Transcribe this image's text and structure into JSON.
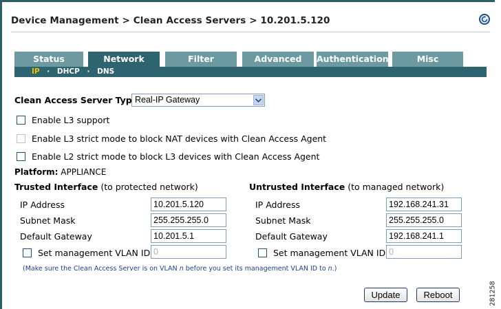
{
  "header": {
    "breadcrumb": "Device Management > Clean Access Servers > 10.201.5.120",
    "help_icon": "help-icon"
  },
  "tabs": [
    {
      "label": "Status",
      "active": false
    },
    {
      "label": "Network",
      "active": true
    },
    {
      "label": "Filter",
      "active": false
    },
    {
      "label": "Advanced",
      "active": false
    },
    {
      "label": "Authentication",
      "active": false
    },
    {
      "label": "Misc",
      "active": false
    }
  ],
  "subnav": {
    "items": [
      "IP",
      "DHCP",
      "DNS"
    ],
    "active": "IP",
    "separator": "·"
  },
  "server_type": {
    "label": "Clean Access Server Type:",
    "value": "Real-IP Gateway"
  },
  "options": {
    "l3_support": {
      "label": "Enable L3 support",
      "checked": false,
      "enabled": true
    },
    "l3_strict": {
      "label": "Enable L3 strict mode to block NAT devices with Clean Access Agent",
      "checked": false,
      "enabled": false
    },
    "l2_strict": {
      "label": "Enable L2 strict mode to block L3 devices with Clean Access Agent",
      "checked": false,
      "enabled": true
    }
  },
  "platform": {
    "label": "Platform:",
    "value": "APPLIANCE"
  },
  "trusted": {
    "title": "Trusted Interface",
    "subtitle": "(to protected network)",
    "ip_label": "IP Address",
    "ip": "10.201.5.120",
    "mask_label": "Subnet Mask",
    "mask": "255.255.255.0",
    "gw_label": "Default Gateway",
    "gw": "10.201.5.1",
    "vlan_label": "Set management VLAN ID:",
    "vlan": "0",
    "vlan_checked": false
  },
  "untrusted": {
    "title": "Untrusted Interface",
    "subtitle": "(to managed network)",
    "ip_label": "IP Address",
    "ip": "192.168.241.31",
    "mask_label": "Subnet Mask",
    "mask": "255.255.255.0",
    "gw_label": "Default Gateway",
    "gw": "192.168.241.1",
    "vlan_label": "Set management VLAN ID:",
    "vlan": "0",
    "vlan_checked": false
  },
  "note": {
    "part1": "(Make sure the Clean Access Server is on VLAN ",
    "var1": "n",
    "part2": " before you set its management VLAN ID to ",
    "var2": "n",
    "part3": ".)"
  },
  "buttons": {
    "update": "Update",
    "reboot": "Reboot"
  },
  "figure_id": "281258",
  "colors": {
    "tab_inactive": "#6c9aa0",
    "tab_active": "#2e6470",
    "subnav_active": "#f2c200",
    "note_text": "#1c3f8c"
  }
}
